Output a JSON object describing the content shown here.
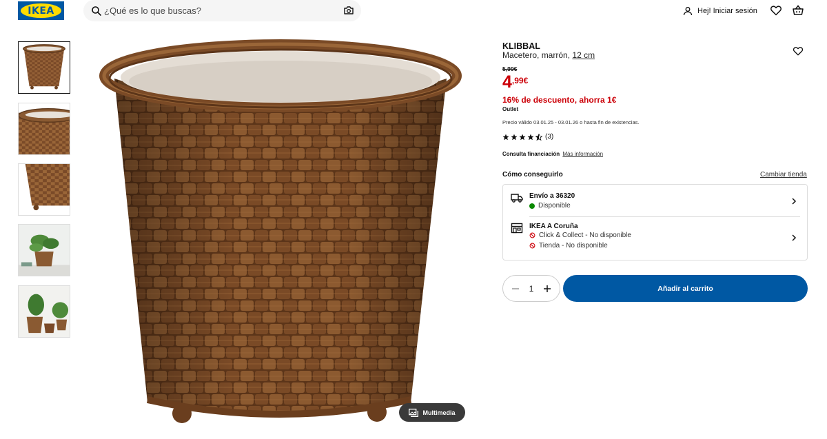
{
  "header": {
    "logo_text": "IKEA",
    "search_placeholder": "¿Qué es lo que buscas?",
    "login_label": "Hej! Iniciar sesión"
  },
  "gallery": {
    "thumbnails": [
      "basket-front",
      "basket-top-crop",
      "basket-feet-crop",
      "basket-with-plant",
      "baskets-with-plants"
    ],
    "multimedia_label": "Multimedia"
  },
  "product": {
    "name": "KLIBBAL",
    "description": "Macetero, marrón,",
    "size": "12 cm",
    "old_price": "5,99€",
    "price_int": "4",
    "price_dec": ",99€",
    "discount": "16% de descuento, ahorra 1€",
    "outlet": "Outlet",
    "validity": "Precio válido 03.01.25 - 03.01.26 o hasta fin de existencias.",
    "rating_count": "(3)",
    "rating_value": 4.5,
    "finance_label": "Consulta financiación",
    "finance_link": "Más información"
  },
  "availability": {
    "title": "Cómo conseguirlo",
    "change_store": "Cambiar tienda",
    "delivery_title": "Envío a 36320",
    "delivery_status": "Disponible",
    "store_title": "IKEA A Coruña",
    "click_collect": "Click & Collect - No disponible",
    "store_status": "Tienda - No disponible"
  },
  "purchase": {
    "quantity": "1",
    "add_to_cart": "Añadir al carrito"
  },
  "colors": {
    "ikea_blue": "#0058a3",
    "ikea_yellow": "#ffdb00",
    "price_red": "#cc0008",
    "available_green": "#0a8a00"
  }
}
